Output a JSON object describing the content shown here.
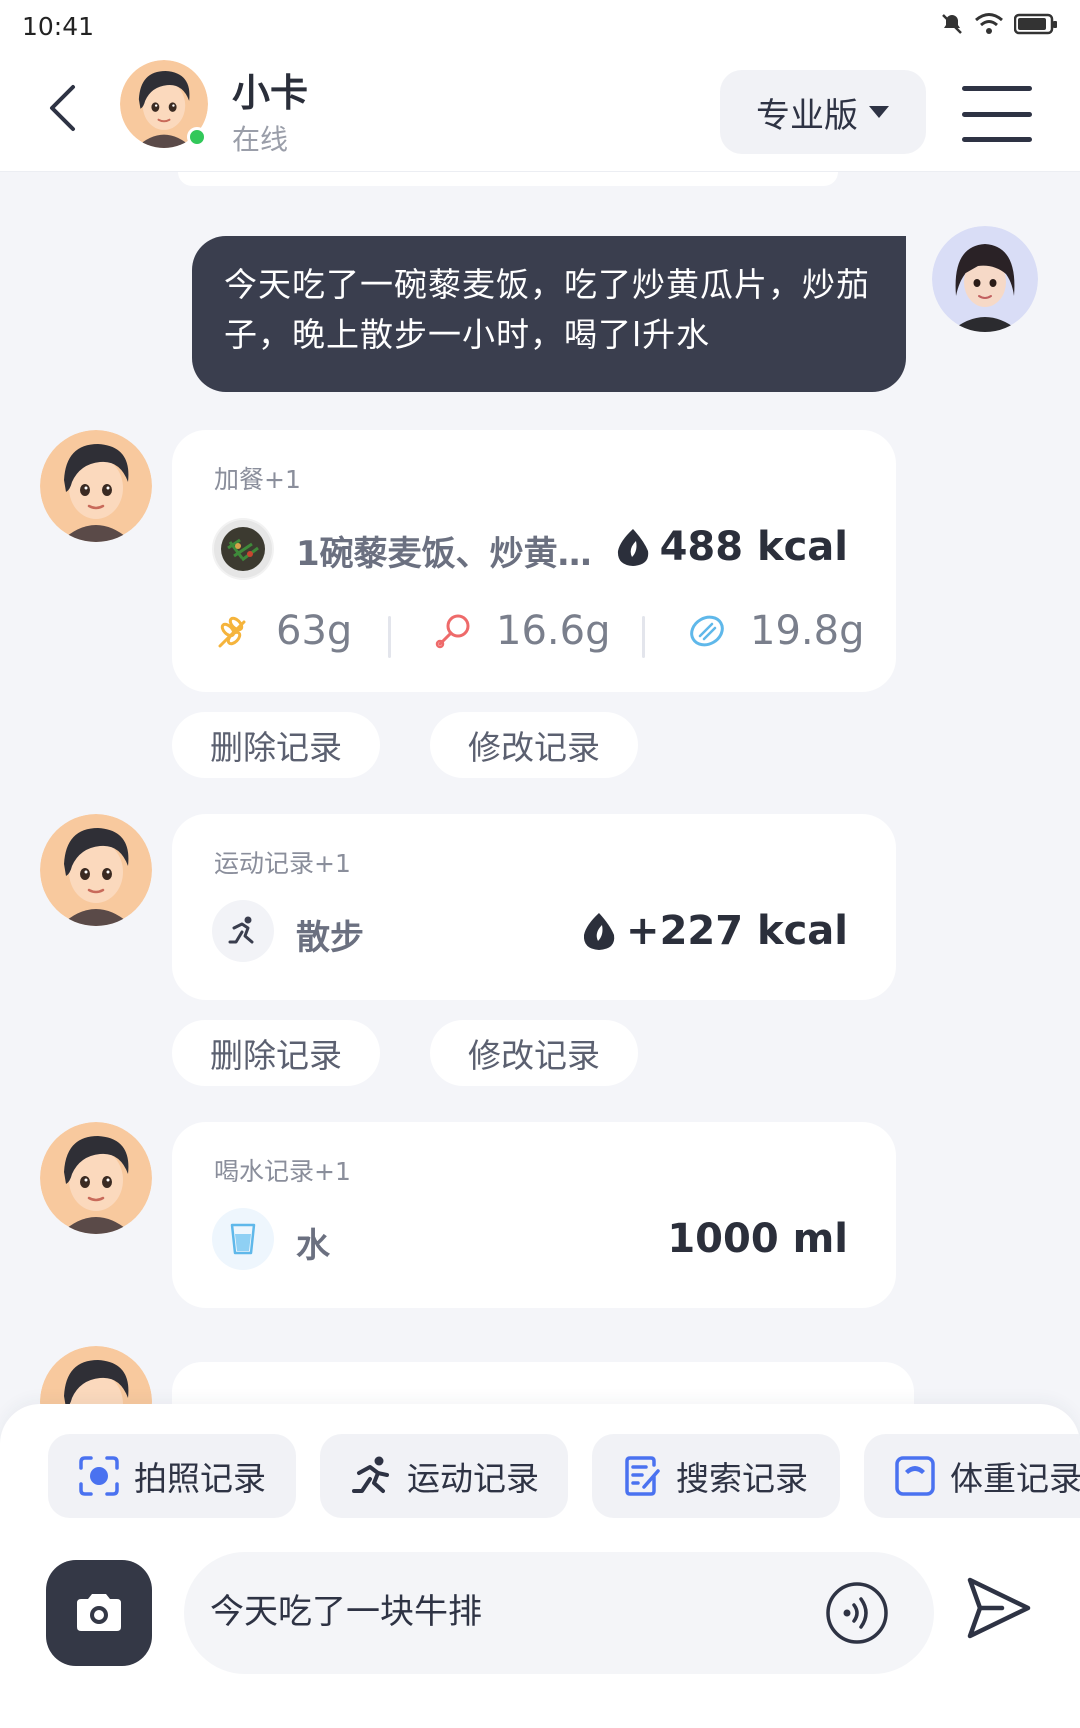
{
  "status_bar": {
    "time": "10:41"
  },
  "header": {
    "title": "小卡",
    "status": "在线",
    "plan_label": "专业版",
    "online_color": "#32c85a"
  },
  "user_message": {
    "text": "今天吃了一碗藜麦饭，吃了炒黄瓜片，炒茄子，晚上散步一小时，喝了l升水"
  },
  "meal_record": {
    "label": "加餐+1",
    "food": "1碗藜麦饭、炒黄…",
    "kcal": "488 kcal",
    "carbs": "63g",
    "protein": "16.6g",
    "fat": "19.8g"
  },
  "exercise_record": {
    "label": "运动记录+1",
    "activity": "散步",
    "kcal": "+227 kcal"
  },
  "water_record": {
    "label": "喝水记录+1",
    "item": "水",
    "amount": "1000 ml"
  },
  "actions": {
    "delete": "删除记录",
    "edit": "修改记录"
  },
  "quick_actions": [
    {
      "label": "拍照记录",
      "icon": "photo-scan-icon"
    },
    {
      "label": "运动记录",
      "icon": "running-icon"
    },
    {
      "label": "搜索记录",
      "icon": "document-edit-icon"
    },
    {
      "label": "体重记录",
      "icon": "scale-icon"
    }
  ],
  "composer": {
    "input_value": "今天吃了一块牛排"
  },
  "colors": {
    "dark_bubble": "#3a3e4e",
    "accent_blue": "#4a72f0",
    "carb_color": "#f5b43c",
    "protein_color": "#ee6a6a",
    "fat_color": "#5fb8ea"
  }
}
